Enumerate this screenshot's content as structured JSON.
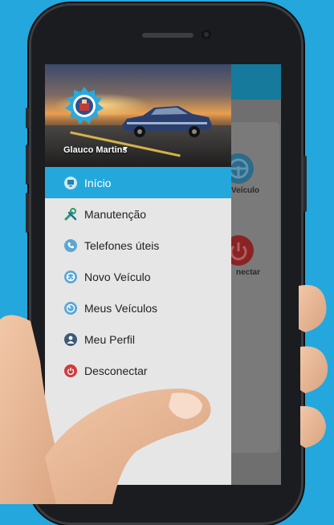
{
  "drawer": {
    "user_name": "Glauco Martins",
    "items": [
      {
        "label": "Início",
        "icon": "monitor-icon",
        "active": true
      },
      {
        "label": "Manutenção",
        "icon": "wrench-screwdriver-icon",
        "active": false
      },
      {
        "label": "Telefones úteis",
        "icon": "phone-icon",
        "active": false
      },
      {
        "label": "Novo Veículo",
        "icon": "steering-wheel-icon",
        "active": false
      },
      {
        "label": "Meus Veículos",
        "icon": "speedometer-icon",
        "active": false
      },
      {
        "label": "Meu Perfil",
        "icon": "user-icon",
        "active": false
      },
      {
        "label": "Desconectar",
        "icon": "power-icon",
        "active": false
      }
    ]
  },
  "background_app": {
    "tile_vehicle_label": "Veículo",
    "tile_disconnect_label": "nectar"
  },
  "colors": {
    "accent": "#24a8dc",
    "background": "#23a7dd",
    "disconnect": "#d23b3b"
  }
}
